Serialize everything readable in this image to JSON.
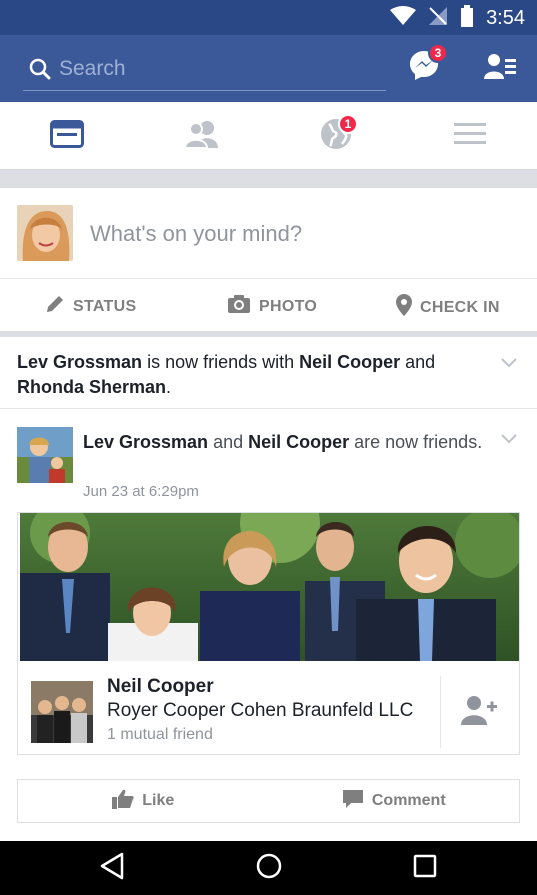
{
  "status_bar": {
    "time": "3:54",
    "icons": [
      "wifi-icon",
      "signal-off-icon",
      "battery-icon"
    ]
  },
  "top_bar": {
    "search_placeholder": "Search",
    "messenger_badge": "3",
    "icons": [
      "search-icon",
      "messenger-icon",
      "friend-requests-icon"
    ]
  },
  "nav_tabs": {
    "items": [
      {
        "name": "news-feed",
        "icon": "news-feed-icon",
        "active": true
      },
      {
        "name": "friends",
        "icon": "friends-icon",
        "active": false
      },
      {
        "name": "notifications",
        "icon": "globe-icon",
        "badge": "1",
        "active": false
      },
      {
        "name": "menu",
        "icon": "hamburger-icon",
        "active": false
      }
    ]
  },
  "composer": {
    "placeholder": "What's on your mind?",
    "actions": [
      {
        "label": "STATUS",
        "icon": "pencil-icon"
      },
      {
        "label": "PHOTO",
        "icon": "camera-icon"
      },
      {
        "label": "CHECK IN",
        "icon": "location-pin-icon"
      }
    ]
  },
  "story1": {
    "actor": "Lev Grossman",
    "text1": " is now friends with ",
    "friend1": "Neil Cooper",
    "text2": " and ",
    "friend2": "Rhonda Sherman",
    "text3": "."
  },
  "post": {
    "actor": "Lev Grossman",
    "text1": " and ",
    "friend": "Neil Cooper",
    "text2": " are now friends.",
    "timestamp": "Jun 23 at 6:29pm",
    "card": {
      "name": "Neil Cooper",
      "work": "Royer Cooper Cohen Braunfeld LLC",
      "mutual": "1 mutual friend"
    },
    "like_label": "Like",
    "comment_label": "Comment"
  },
  "colors": {
    "brand": "#3b5998",
    "status_bar": "#2b4886",
    "badge": "#f02849",
    "muted_text": "#90949c"
  }
}
